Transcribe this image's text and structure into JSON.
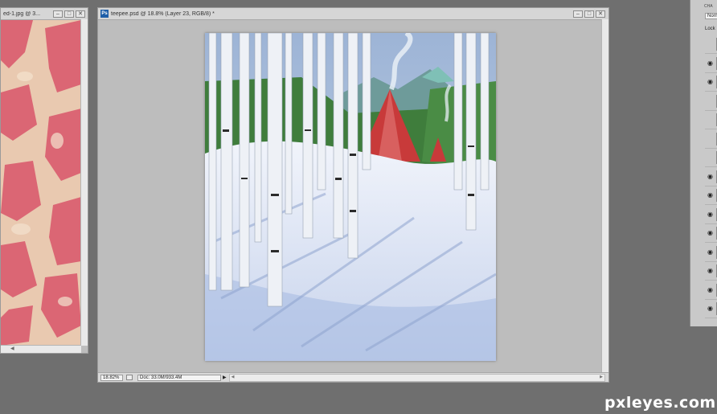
{
  "left_window": {
    "title": "ed-1.jpg @ 3...",
    "controls": [
      "–",
      "□",
      "✕"
    ]
  },
  "main_window": {
    "title": "teepee.psd @ 18.8% (Layer 23, RGB/8) *",
    "app_badge": "Ps",
    "controls": [
      "–",
      "□",
      "✕"
    ],
    "zoom": "18.82%",
    "doc_info": "Doc: 33.0M/933.4M"
  },
  "layers_panel": {
    "tab_label": "CHA",
    "blend_mode": "Norm",
    "lock_label": "Lock",
    "rows": [
      {
        "visible": false
      },
      {
        "visible": true
      },
      {
        "visible": true
      },
      {
        "visible": false
      },
      {
        "visible": false
      },
      {
        "visible": false
      },
      {
        "visible": false
      },
      {
        "visible": true
      },
      {
        "visible": true
      },
      {
        "visible": true
      },
      {
        "visible": true
      },
      {
        "visible": true
      },
      {
        "visible": true
      },
      {
        "visible": true
      },
      {
        "visible": true
      }
    ]
  },
  "watermark": "pxleyes.com",
  "colors": {
    "workspace": "#6f6f6f",
    "canvas_bg": "#bdbdbd",
    "teepee": "#c83a3a",
    "snow": "#dfe6f5",
    "accent_ps": "#1f5fa8"
  }
}
